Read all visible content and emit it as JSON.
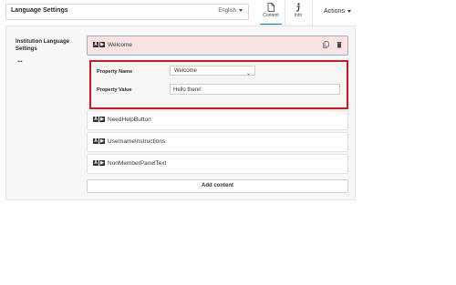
{
  "header": {
    "title": "Language Settings",
    "language": "English",
    "tabs": [
      {
        "label": "Content",
        "icon": "document-icon"
      },
      {
        "label": "Info",
        "icon": "info-icon"
      }
    ],
    "actions_label": "Actions"
  },
  "panel": {
    "section_label": "Institution Language Settings",
    "more": "...",
    "items": [
      {
        "label": "Welcome",
        "selected": true
      },
      {
        "label": "NeedHelpButton"
      },
      {
        "label": "UsernameInstructions"
      },
      {
        "label": "NonMemberPanelText"
      }
    ],
    "properties": {
      "name_label": "Property Name",
      "name_value": "Welcome",
      "value_label": "Property Value",
      "value_value": "Hello there!"
    },
    "add_content_label": "Add content"
  },
  "colors": {
    "accent": "#2b6cb0",
    "selected_bg": "#fbe3e3",
    "highlight_border": "#d7141e"
  }
}
